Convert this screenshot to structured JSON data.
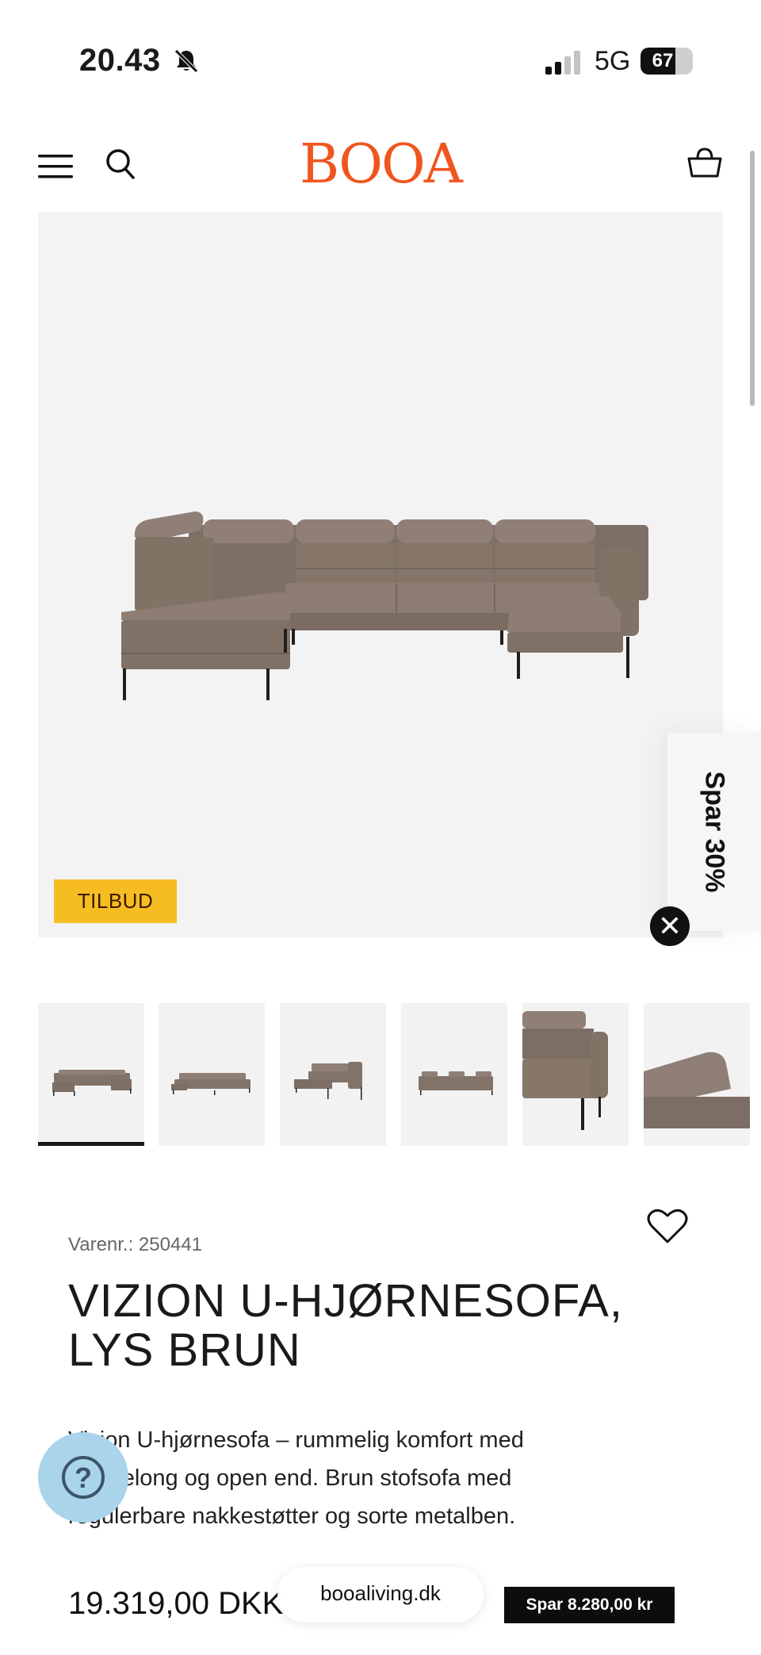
{
  "status_bar": {
    "time": "20.43",
    "network": "5G",
    "battery": "67",
    "battery_level": 0.67
  },
  "header": {
    "logo": "BOOA",
    "brand_color": "#f0551f"
  },
  "product": {
    "badge": "TILBUD",
    "sku": "Varenr.: 250441",
    "title": "VIZION U-HJØRNESOFA, LYS BRUN",
    "description": "Vizion U-hjørnesofa – rummelig komfort med chaiselong og open end. Brun stofsofa med regulerbare nakkestøtter og sorte metalben.",
    "price": "19.319,00 DKK",
    "savings": "Spar 8.280,00 kr"
  },
  "promo_tab": {
    "label": "Spar 30%"
  },
  "browser": {
    "url": "booaliving.dk"
  },
  "gallery": {
    "thumbnail_count": 6,
    "active_index": 0
  },
  "colors": {
    "badge": "#f6bd22",
    "sofa": "#8a7a70",
    "help": "#a9d4ea"
  },
  "icons": [
    "bell-slash-icon",
    "signal-icon",
    "battery-icon",
    "menu-icon",
    "search-icon",
    "cart-icon",
    "heart-icon",
    "close-icon",
    "help-icon"
  ]
}
